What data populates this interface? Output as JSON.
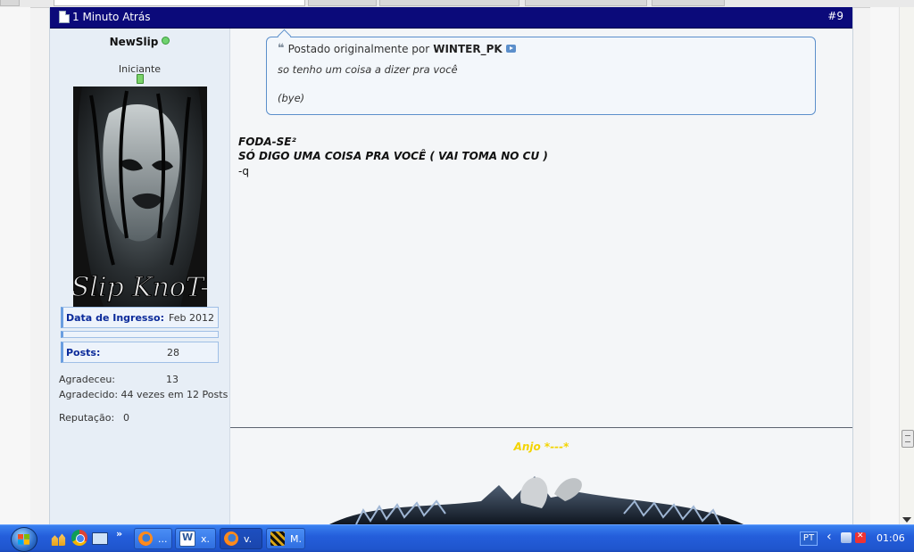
{
  "post": {
    "date": "1 Minuto Atrás",
    "number": "#9"
  },
  "user": {
    "name": "NewSlip",
    "title": "Iniciante",
    "join_label": "Data de Ingresso",
    "join_value": "Feb 2012",
    "posts_label": "Posts",
    "posts_value": "28",
    "thanks_given_label": "Agradeceu:",
    "thanks_given_value": "13",
    "thanked_line": "Agradecido: 44 vezes em 12 Posts",
    "reputation_label": "Reputação:",
    "reputation_value": "0"
  },
  "quote": {
    "prefix": "Postado originalmente por",
    "author": "WINTER_PK",
    "line1": "so tenho um coisa a dizer pra você",
    "line2": "(bye)"
  },
  "message": {
    "line1": "FODA-SE²",
    "line2": "SÓ DIGO UMA COISA PRA VOCÊ ( VAI TOMA NO CU )",
    "line3": "-q"
  },
  "signature": {
    "text": "Anjo *---*"
  },
  "taskbar": {
    "more": "»",
    "tasks": [
      {
        "label": "..."
      },
      {
        "label": "x."
      },
      {
        "label": "v."
      },
      {
        "label": "M."
      }
    ],
    "language": "PT",
    "clock": "01:06"
  },
  "colors": {
    "post_header": "#0b0a7a",
    "signature_text": "#f3d400",
    "info_label": "#0a2a9a"
  }
}
